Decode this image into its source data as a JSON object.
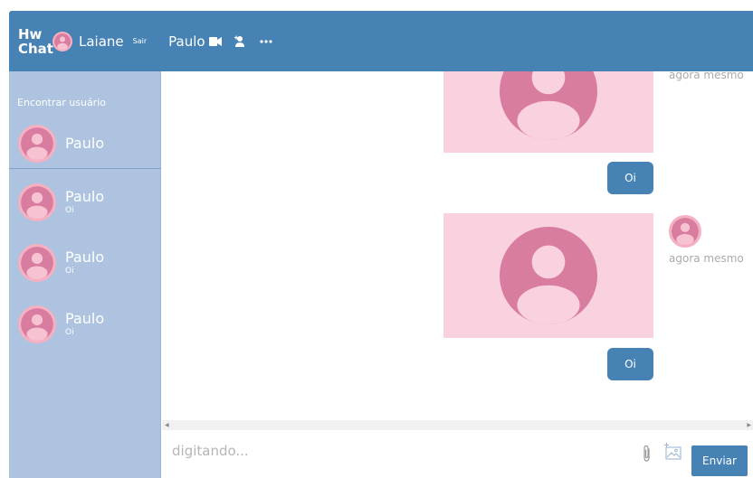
{
  "header": {
    "brand_line1": "Hw",
    "brand_line2": "Chat",
    "user_name": "Laiane",
    "logout_label": "Sair",
    "contact_name": "Paulo"
  },
  "sidebar": {
    "find_user_label": "Encontrar usuário",
    "search_result": {
      "name": "Paulo"
    },
    "conversations": [
      {
        "name": "Paulo",
        "last_message": "Oi"
      },
      {
        "name": "Paulo",
        "last_message": "Oi"
      },
      {
        "name": "Paulo",
        "last_message": "Oi"
      }
    ]
  },
  "messages": {
    "items": [
      {
        "type": "image",
        "timestamp": "agora mesmo"
      },
      {
        "type": "text",
        "text": "Oi"
      },
      {
        "type": "image",
        "timestamp": "agora mesmo"
      },
      {
        "type": "text",
        "text": "Oi"
      }
    ]
  },
  "composer": {
    "placeholder": "digitando...",
    "send_label": "Enviar"
  },
  "colors": {
    "primary": "#4782b4",
    "sidebar": "#adc3e0",
    "avatar_pink": "#f7c3d2",
    "avatar_figure": "#d87d9f",
    "image_bg": "#f9d1df"
  },
  "icons": [
    "user-avatar-icon",
    "video-camera-icon",
    "add-user-icon",
    "more-options-icon",
    "paperclip-icon",
    "image-icon"
  ]
}
